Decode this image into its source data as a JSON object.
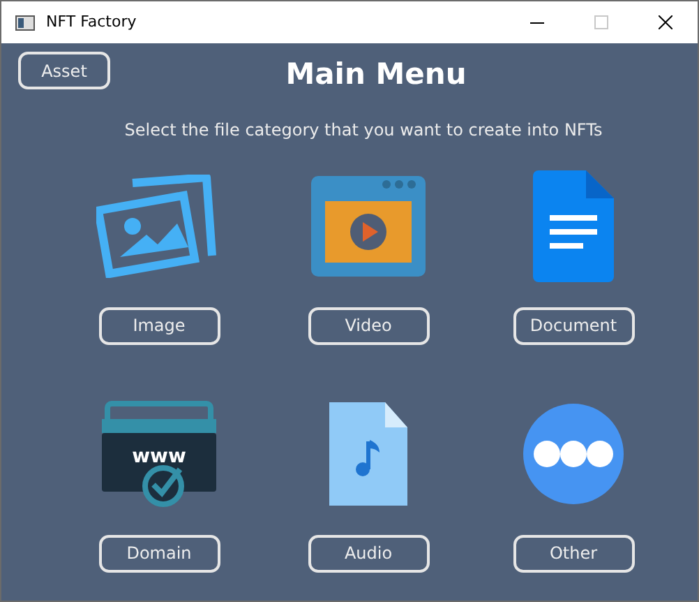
{
  "window": {
    "title": "NFT Factory",
    "maximize_disabled": true
  },
  "asset_button": "Asset",
  "title": "Main Menu",
  "subtitle": "Select the file category that you want to create into NFTs",
  "categories": [
    {
      "kind": "image",
      "label": "Image"
    },
    {
      "kind": "video",
      "label": "Video"
    },
    {
      "kind": "document",
      "label": "Document"
    },
    {
      "kind": "domain",
      "label": "Domain",
      "icon_text": "www"
    },
    {
      "kind": "audio",
      "label": "Audio"
    },
    {
      "kind": "other",
      "label": "Other"
    }
  ]
}
